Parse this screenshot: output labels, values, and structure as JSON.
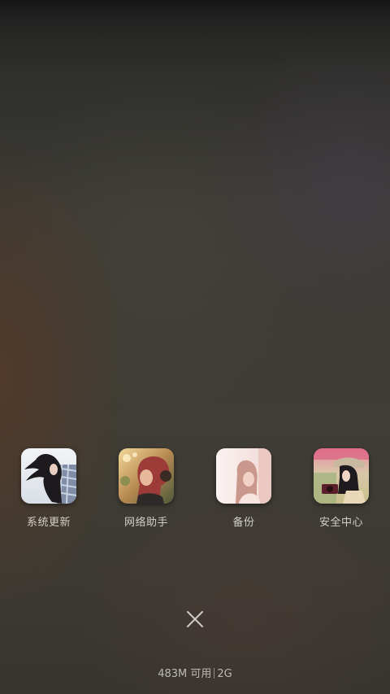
{
  "recent_apps": [
    {
      "label": "系统更新",
      "thumbnail": "photo-girl-wind-plaid-shirt"
    },
    {
      "label": "网络助手",
      "thumbnail": "photo-girl-sunset-bokeh"
    },
    {
      "label": "备份",
      "thumbnail": "photo-girl-pale-pink"
    },
    {
      "label": "安全中心",
      "thumbnail": "photo-girl-camera-hat"
    }
  ],
  "close_icon": "close-icon",
  "memory": {
    "available": "483M 可用",
    "total": "2G"
  },
  "colors": {
    "label_text": "#d2cfca",
    "memory_text": "#bdbab5"
  }
}
